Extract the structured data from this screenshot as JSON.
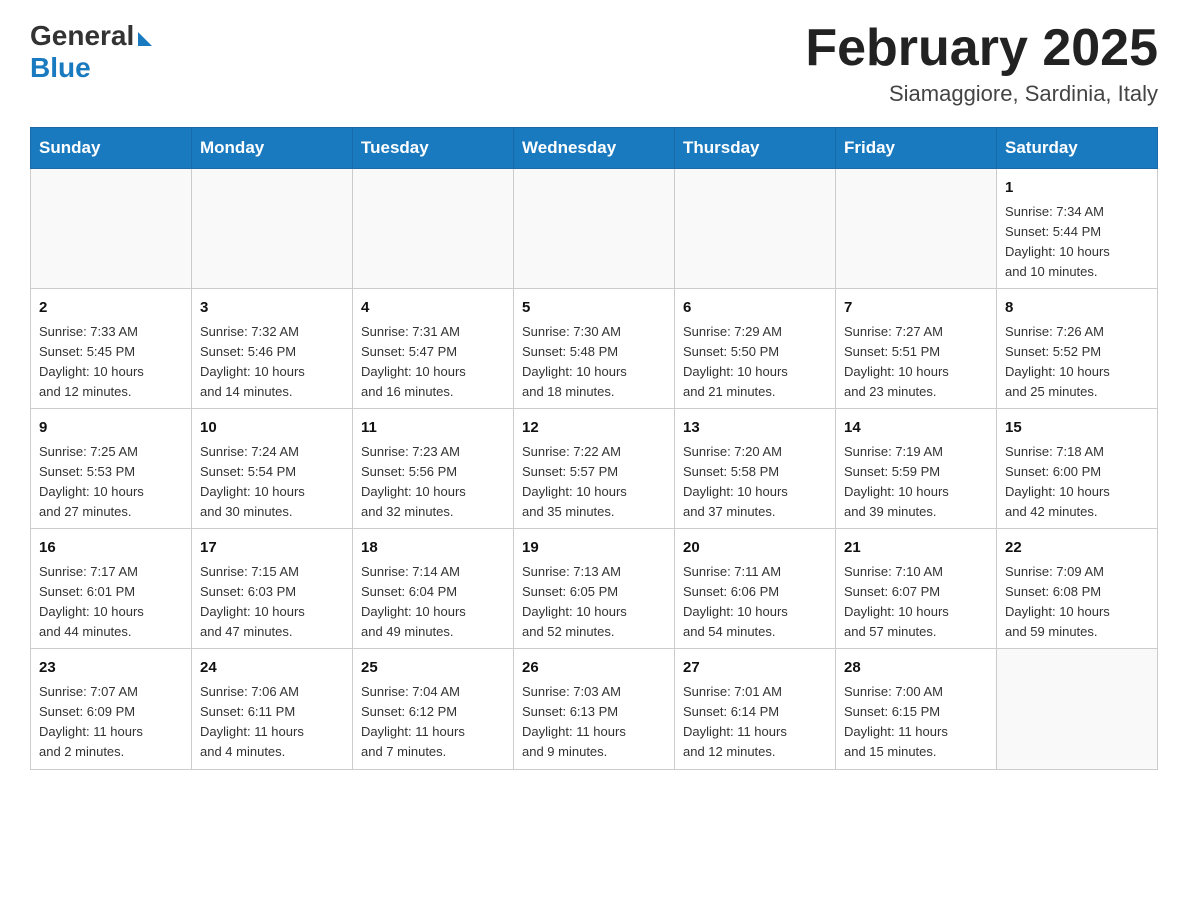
{
  "header": {
    "logo_general": "General",
    "logo_blue": "Blue",
    "month_title": "February 2025",
    "location": "Siamaggiore, Sardinia, Italy"
  },
  "days_of_week": [
    "Sunday",
    "Monday",
    "Tuesday",
    "Wednesday",
    "Thursday",
    "Friday",
    "Saturday"
  ],
  "weeks": [
    [
      {
        "day": "",
        "info": ""
      },
      {
        "day": "",
        "info": ""
      },
      {
        "day": "",
        "info": ""
      },
      {
        "day": "",
        "info": ""
      },
      {
        "day": "",
        "info": ""
      },
      {
        "day": "",
        "info": ""
      },
      {
        "day": "1",
        "info": "Sunrise: 7:34 AM\nSunset: 5:44 PM\nDaylight: 10 hours\nand 10 minutes."
      }
    ],
    [
      {
        "day": "2",
        "info": "Sunrise: 7:33 AM\nSunset: 5:45 PM\nDaylight: 10 hours\nand 12 minutes."
      },
      {
        "day": "3",
        "info": "Sunrise: 7:32 AM\nSunset: 5:46 PM\nDaylight: 10 hours\nand 14 minutes."
      },
      {
        "day": "4",
        "info": "Sunrise: 7:31 AM\nSunset: 5:47 PM\nDaylight: 10 hours\nand 16 minutes."
      },
      {
        "day": "5",
        "info": "Sunrise: 7:30 AM\nSunset: 5:48 PM\nDaylight: 10 hours\nand 18 minutes."
      },
      {
        "day": "6",
        "info": "Sunrise: 7:29 AM\nSunset: 5:50 PM\nDaylight: 10 hours\nand 21 minutes."
      },
      {
        "day": "7",
        "info": "Sunrise: 7:27 AM\nSunset: 5:51 PM\nDaylight: 10 hours\nand 23 minutes."
      },
      {
        "day": "8",
        "info": "Sunrise: 7:26 AM\nSunset: 5:52 PM\nDaylight: 10 hours\nand 25 minutes."
      }
    ],
    [
      {
        "day": "9",
        "info": "Sunrise: 7:25 AM\nSunset: 5:53 PM\nDaylight: 10 hours\nand 27 minutes."
      },
      {
        "day": "10",
        "info": "Sunrise: 7:24 AM\nSunset: 5:54 PM\nDaylight: 10 hours\nand 30 minutes."
      },
      {
        "day": "11",
        "info": "Sunrise: 7:23 AM\nSunset: 5:56 PM\nDaylight: 10 hours\nand 32 minutes."
      },
      {
        "day": "12",
        "info": "Sunrise: 7:22 AM\nSunset: 5:57 PM\nDaylight: 10 hours\nand 35 minutes."
      },
      {
        "day": "13",
        "info": "Sunrise: 7:20 AM\nSunset: 5:58 PM\nDaylight: 10 hours\nand 37 minutes."
      },
      {
        "day": "14",
        "info": "Sunrise: 7:19 AM\nSunset: 5:59 PM\nDaylight: 10 hours\nand 39 minutes."
      },
      {
        "day": "15",
        "info": "Sunrise: 7:18 AM\nSunset: 6:00 PM\nDaylight: 10 hours\nand 42 minutes."
      }
    ],
    [
      {
        "day": "16",
        "info": "Sunrise: 7:17 AM\nSunset: 6:01 PM\nDaylight: 10 hours\nand 44 minutes."
      },
      {
        "day": "17",
        "info": "Sunrise: 7:15 AM\nSunset: 6:03 PM\nDaylight: 10 hours\nand 47 minutes."
      },
      {
        "day": "18",
        "info": "Sunrise: 7:14 AM\nSunset: 6:04 PM\nDaylight: 10 hours\nand 49 minutes."
      },
      {
        "day": "19",
        "info": "Sunrise: 7:13 AM\nSunset: 6:05 PM\nDaylight: 10 hours\nand 52 minutes."
      },
      {
        "day": "20",
        "info": "Sunrise: 7:11 AM\nSunset: 6:06 PM\nDaylight: 10 hours\nand 54 minutes."
      },
      {
        "day": "21",
        "info": "Sunrise: 7:10 AM\nSunset: 6:07 PM\nDaylight: 10 hours\nand 57 minutes."
      },
      {
        "day": "22",
        "info": "Sunrise: 7:09 AM\nSunset: 6:08 PM\nDaylight: 10 hours\nand 59 minutes."
      }
    ],
    [
      {
        "day": "23",
        "info": "Sunrise: 7:07 AM\nSunset: 6:09 PM\nDaylight: 11 hours\nand 2 minutes."
      },
      {
        "day": "24",
        "info": "Sunrise: 7:06 AM\nSunset: 6:11 PM\nDaylight: 11 hours\nand 4 minutes."
      },
      {
        "day": "25",
        "info": "Sunrise: 7:04 AM\nSunset: 6:12 PM\nDaylight: 11 hours\nand 7 minutes."
      },
      {
        "day": "26",
        "info": "Sunrise: 7:03 AM\nSunset: 6:13 PM\nDaylight: 11 hours\nand 9 minutes."
      },
      {
        "day": "27",
        "info": "Sunrise: 7:01 AM\nSunset: 6:14 PM\nDaylight: 11 hours\nand 12 minutes."
      },
      {
        "day": "28",
        "info": "Sunrise: 7:00 AM\nSunset: 6:15 PM\nDaylight: 11 hours\nand 15 minutes."
      },
      {
        "day": "",
        "info": ""
      }
    ]
  ]
}
